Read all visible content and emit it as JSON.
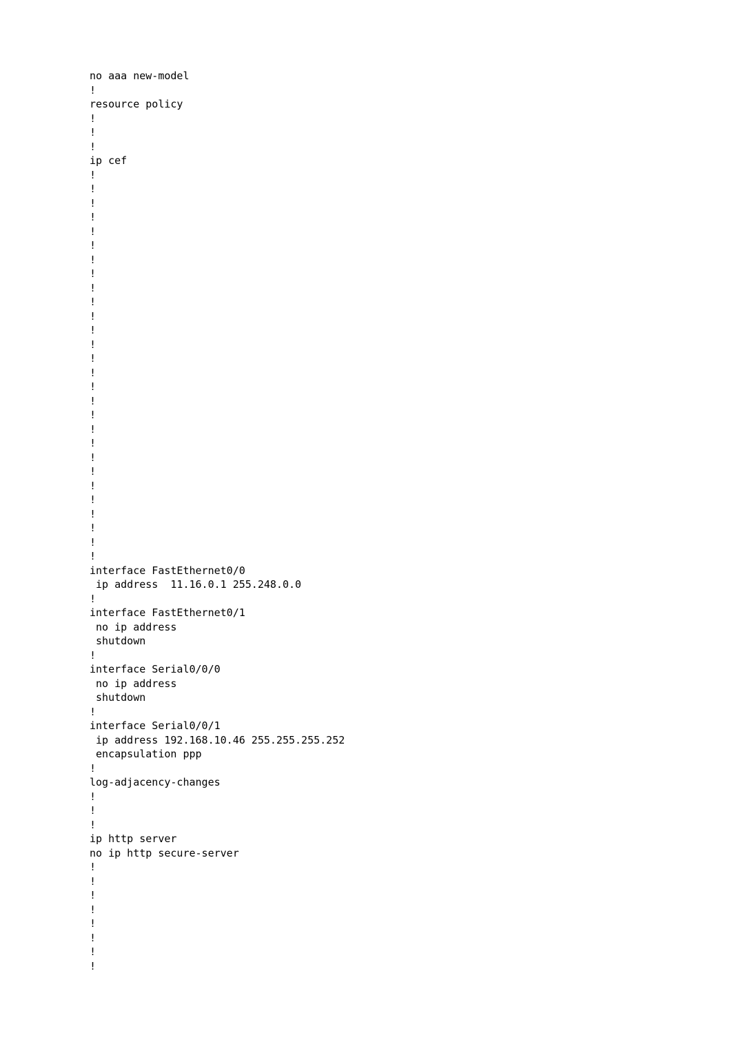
{
  "config": {
    "lines": [
      "no aaa new-model",
      "!",
      "resource policy",
      "!",
      "!",
      "!",
      "ip cef",
      "!",
      "!",
      "!",
      "!",
      "!",
      "!",
      "!",
      "!",
      "!",
      "!",
      "!",
      "!",
      "!",
      "!",
      "!",
      "!",
      "!",
      "!",
      "!",
      "!",
      "!",
      "!",
      "!",
      "!",
      "!",
      "!",
      "!",
      "!",
      "interface FastEthernet0/0",
      " ip address  11.16.0.1 255.248.0.0",
      "!",
      "interface FastEthernet0/1",
      " no ip address",
      " shutdown",
      "!",
      "interface Serial0/0/0",
      " no ip address",
      " shutdown",
      "!",
      "interface Serial0/0/1",
      " ip address 192.168.10.46 255.255.255.252",
      " encapsulation ppp",
      "!",
      "log-adjacency-changes",
      "!",
      "!",
      "!",
      "ip http server",
      "no ip http secure-server",
      "!",
      "!",
      "!",
      "!",
      "!",
      "!",
      "!",
      "!"
    ]
  }
}
